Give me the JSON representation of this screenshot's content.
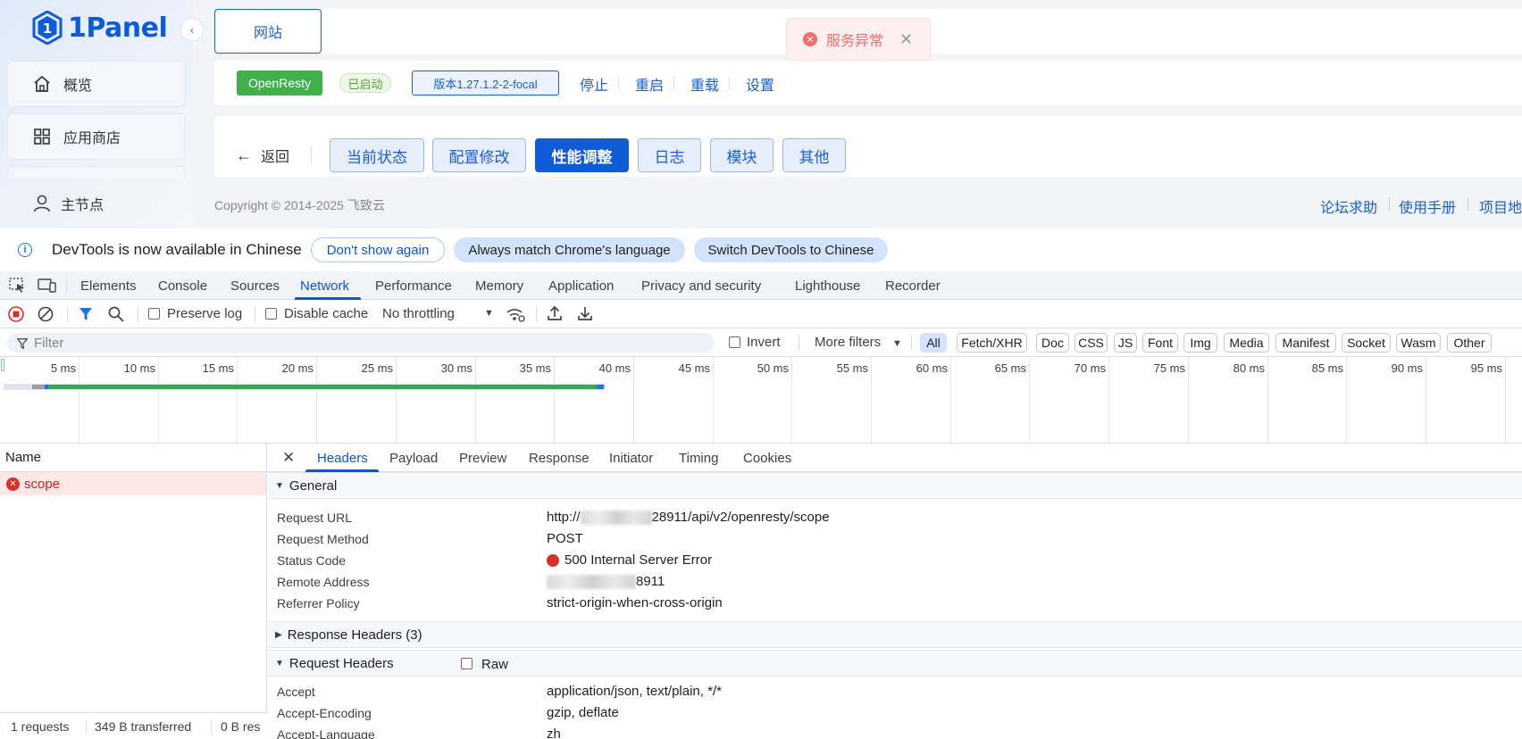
{
  "app": {
    "logo_text": "1Panel",
    "sidebar": {
      "items": [
        {
          "label": "概览",
          "icon": "home-icon"
        },
        {
          "label": "应用商店",
          "icon": "grid-icon"
        }
      ],
      "node_label": "主节点"
    },
    "top_tab": "网站",
    "toast": {
      "message": "服务异常"
    },
    "status": {
      "app_tag": "OpenResty",
      "running_tag": "已启动",
      "version_tag": "版本1.27.1.2-2-focal",
      "actions": [
        "停止",
        "重启",
        "重载",
        "设置"
      ]
    },
    "subnav": {
      "back_label": "返回",
      "tabs": [
        "当前状态",
        "配置修改",
        "性能调整",
        "日志",
        "模块",
        "其他"
      ],
      "active_tab": "性能调整"
    },
    "footer": {
      "copyright": "Copyright © 2014-2025 飞致云",
      "links": [
        "论坛求助",
        "使用手册",
        "项目地"
      ]
    }
  },
  "devtools": {
    "infobar": {
      "message": "DevTools is now available in Chinese",
      "buttons": [
        "Don't show again",
        "Always match Chrome's language",
        "Switch DevTools to Chinese"
      ]
    },
    "tabs": [
      "Elements",
      "Console",
      "Sources",
      "Network",
      "Performance",
      "Memory",
      "Application",
      "Privacy and security",
      "Lighthouse",
      "Recorder"
    ],
    "active_tab": "Network",
    "toolbar": {
      "preserve_log": "Preserve log",
      "disable_cache": "Disable cache",
      "throttling": "No throttling"
    },
    "filter": {
      "placeholder": "Filter",
      "invert": "Invert",
      "more_filters": "More filters",
      "types": [
        "All",
        "Fetch/XHR",
        "Doc",
        "CSS",
        "JS",
        "Font",
        "Img",
        "Media",
        "Manifest",
        "Socket",
        "Wasm",
        "Other"
      ],
      "active_type": "All"
    },
    "timeline": {
      "ticks": [
        "5 ms",
        "10 ms",
        "15 ms",
        "20 ms",
        "25 ms",
        "30 ms",
        "35 ms",
        "40 ms",
        "45 ms",
        "50 ms",
        "55 ms",
        "60 ms",
        "65 ms",
        "70 ms",
        "75 ms",
        "80 ms",
        "85 ms",
        "90 ms",
        "95 ms"
      ]
    },
    "requests": {
      "header": "Name",
      "rows": [
        {
          "name": "scope",
          "status": "error"
        }
      ],
      "summary": [
        "1 requests",
        "349 B transferred",
        "0 B res"
      ]
    },
    "details": {
      "tabs": [
        "Headers",
        "Payload",
        "Preview",
        "Response",
        "Initiator",
        "Timing",
        "Cookies"
      ],
      "active_tab": "Headers",
      "general_title": "General",
      "general": [
        {
          "key": "Request URL",
          "value": "28911/api/v2/openresty/scope",
          "prefix": "http://"
        },
        {
          "key": "Request Method",
          "value": "POST"
        },
        {
          "key": "Status Code",
          "value": "500 Internal Server Error"
        },
        {
          "key": "Remote Address",
          "value": "8911"
        },
        {
          "key": "Referrer Policy",
          "value": "strict-origin-when-cross-origin"
        }
      ],
      "response_headers_title": "Response Headers (3)",
      "request_headers_title": "Request Headers",
      "raw_label": "Raw",
      "request_headers": [
        {
          "key": "Accept",
          "value": "application/json, text/plain, */*"
        },
        {
          "key": "Accept-Encoding",
          "value": "gzip, deflate"
        },
        {
          "key": "Accept-Language",
          "value": "zh"
        }
      ]
    }
  }
}
